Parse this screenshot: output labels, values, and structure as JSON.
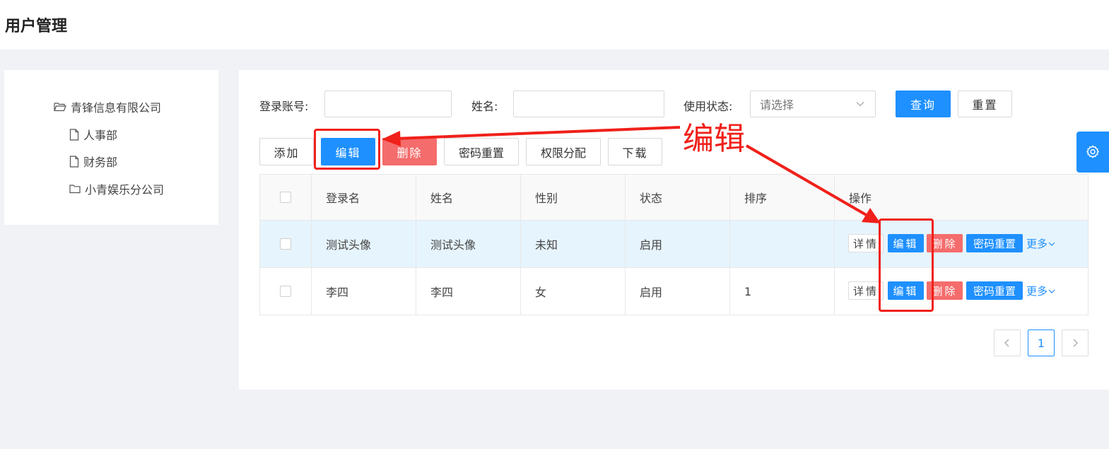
{
  "page": {
    "title": "用户管理"
  },
  "tree": {
    "root": "青锋信息有限公司",
    "children": [
      "人事部",
      "财务部",
      "小青娱乐分公司"
    ]
  },
  "filters": {
    "account_label": "登录账号:",
    "account_value": "",
    "name_label": "姓名:",
    "name_value": "",
    "status_label": "使用状态:",
    "status_placeholder": "请选择",
    "query_label": "查询",
    "reset_label": "重置"
  },
  "toolbar": {
    "add": "添加",
    "edit": "编辑",
    "delete": "删除",
    "reset_password": "密码重置",
    "assign_permissions": "权限分配",
    "download": "下载"
  },
  "table": {
    "columns": [
      "登录名",
      "姓名",
      "性别",
      "状态",
      "排序",
      "操作"
    ],
    "rows": [
      {
        "login": "测试头像",
        "name": "测试头像",
        "gender": "未知",
        "status": "启用",
        "order": ""
      },
      {
        "login": "李四",
        "name": "李四",
        "gender": "女",
        "status": "启用",
        "order": "1"
      }
    ],
    "row_actions": {
      "detail": "详情",
      "edit": "编辑",
      "delete": "删除",
      "reset": "密码重置",
      "more": "更多"
    }
  },
  "pagination": {
    "current": "1"
  },
  "annotation": {
    "label": "编辑",
    "color": "#f0201a"
  },
  "colors": {
    "primary": "#1e90ff",
    "danger": "#f56c6c",
    "annotation": "#f0201a"
  }
}
